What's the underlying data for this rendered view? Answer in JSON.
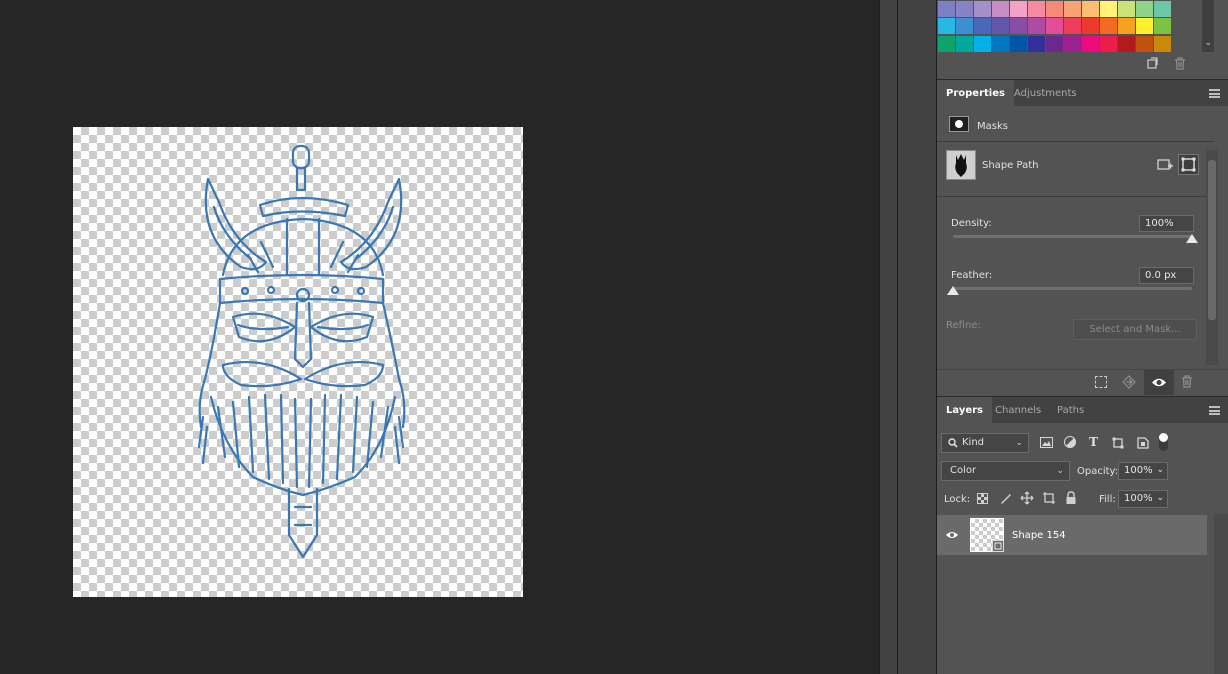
{
  "colors": {
    "workspace": "#262626",
    "panel": "#535353",
    "selected_layer": "#6a6a6a",
    "artwork_stroke": "#3a78b5"
  },
  "swatches": {
    "rows": [
      [
        "#7d7fc5",
        "#8a82c6",
        "#a48fc8",
        "#c58fc6",
        "#f3a1c7",
        "#f58b9f",
        "#f58a78",
        "#f6a273",
        "#fbbf73",
        "#fff275",
        "#c9e27b",
        "#8fd38a",
        "#6cc7a8"
      ],
      [
        "#28b8e8",
        "#3d8fd0",
        "#4a67b8",
        "#6158aa",
        "#884ea6",
        "#b04ba2",
        "#e24e9a",
        "#ee3e5e",
        "#ec3b2e",
        "#f36a23",
        "#f7a21f",
        "#fff031",
        "#7fc243"
      ],
      [
        "#0fa36c",
        "#00a99b",
        "#00b2e8",
        "#0077c0",
        "#0055a5",
        "#34309a",
        "#6d2890",
        "#9e1f8f",
        "#ee0b7c",
        "#ed1c4a",
        "#b01b1f",
        "#c2510f",
        "#c98a07"
      ]
    ]
  },
  "properties": {
    "tabs": [
      {
        "label": "Properties",
        "active": true
      },
      {
        "label": "Adjustments",
        "active": false
      }
    ],
    "masks_label": "Masks",
    "shape_path_label": "Shape Path",
    "density_label": "Density:",
    "density_value": "100%",
    "density_level": 1.0,
    "feather_label": "Feather:",
    "feather_value": "0.0 px",
    "feather_level": 0.0,
    "refine_label": "Refine:",
    "select_and_mask_label": "Select and Mask..."
  },
  "layers": {
    "tabs": [
      {
        "label": "Layers",
        "active": true
      },
      {
        "label": "Channels",
        "active": false
      },
      {
        "label": "Paths",
        "active": false
      }
    ],
    "filter_kind": "Kind",
    "blend_mode": "Color",
    "opacity_label": "Opacity:",
    "opacity_value": "100%",
    "lock_label": "Lock:",
    "fill_label": "Fill:",
    "fill_value": "100%",
    "items": [
      {
        "name": "Shape 154",
        "visible": true,
        "selected": true
      }
    ]
  },
  "icons": {
    "new_swatch": "new-swatch-icon",
    "delete": "trash-icon",
    "visibility": "eye-icon",
    "search": "search-icon"
  }
}
